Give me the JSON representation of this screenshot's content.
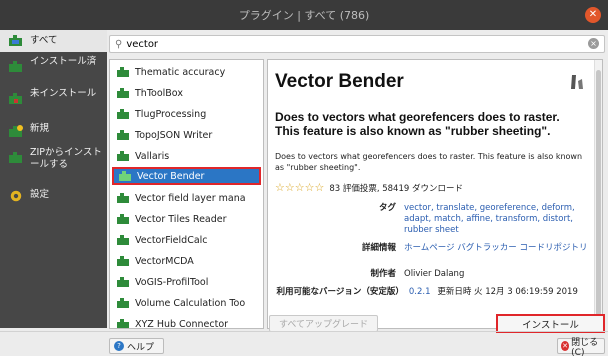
{
  "window": {
    "title": "プラグイン | すべて (786)"
  },
  "sidebar": {
    "items": [
      {
        "label": "すべて",
        "icon": "puzzle-icon"
      },
      {
        "label": "インストール済",
        "icon": "installed-plugin-icon"
      },
      {
        "label": "未インストール",
        "icon": "not-installed-plugin-icon"
      },
      {
        "label": "新規",
        "icon": "new-plugin-icon"
      },
      {
        "label": "ZIPからインストールする",
        "icon": "zip-install-icon"
      },
      {
        "label": "設定",
        "icon": "settings-gear-icon"
      }
    ]
  },
  "search": {
    "value": "vector",
    "placeholder": ""
  },
  "plugin_list": {
    "items": [
      "Thematic accuracy",
      "ThToolBox",
      "TlugProcessing",
      "TopoJSON Writer",
      "Vallaris",
      "Vector Bender",
      "Vector field layer mana",
      "Vector Tiles Reader",
      "VectorFieldCalc",
      "VectorMCDA",
      "VoGIS-ProfilTool",
      "Volume Calculation Too",
      "XYZ Hub Connector"
    ],
    "selected": "Vector Bender"
  },
  "details": {
    "name": "Vector Bender",
    "summary": "Does to vectors what georefencers does to raster. This feature is also known as \"rubber sheeting\".",
    "description": "Does to vectors what georefencers does to raster. This feature is also known as \"rubber sheeting\".",
    "rating": {
      "stars": 5,
      "votes_text": "83 評価投票, 58419 ダウンロード"
    },
    "tags_label": "タグ",
    "tags": "vector, translate, georeference, deform, adapt, match, affine, transform, distort, rubber sheet",
    "more_info_label": "詳細情報",
    "more_info_links": "ホームページ バグトラッカー コードリポジトリ",
    "author_label": "制作者",
    "author": "Olivier Dalang",
    "version_label": "利用可能なバージョン（安定版）",
    "version": "0.2.1",
    "version_updated": "更新日時 火 12月 3 06:19:59 2019"
  },
  "buttons": {
    "upgrade_all": "すべてアップグレード",
    "install": "インストール",
    "help": "ヘルプ",
    "close": "閉じる(C)"
  },
  "colors": {
    "accent": "#2b76c5",
    "highlight_border": "#e0262a",
    "close_icon": "#e2572b",
    "star": "#d9a520"
  }
}
